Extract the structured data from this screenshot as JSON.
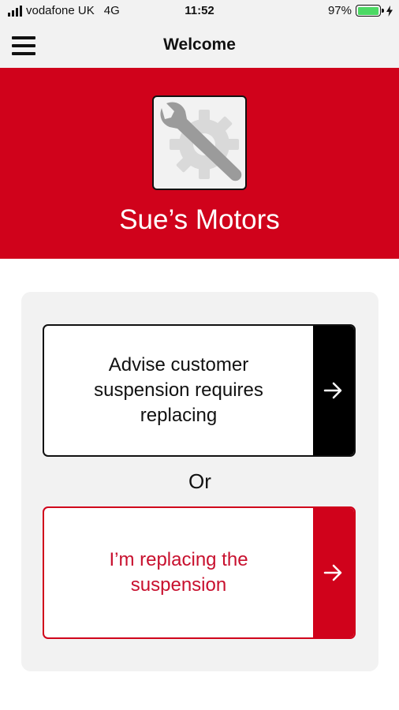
{
  "status_bar": {
    "carrier": "vodafone UK",
    "network": "4G",
    "time": "11:52",
    "battery_percent": "97%",
    "battery_level": 0.97
  },
  "nav": {
    "title": "Welcome",
    "menu_icon": "hamburger-menu-icon"
  },
  "hero": {
    "title": "Sue’s Motors",
    "logo_icon": "wrench-gear-icon",
    "background_color": "#d0021b"
  },
  "options": {
    "advise_label": "Advise customer suspension requires replacing",
    "or_label": "Or",
    "replace_label": "I’m replacing the suspension",
    "arrow_icon": "arrow-right-icon"
  },
  "colors": {
    "brand_red": "#d0021b",
    "dark": "#111111",
    "card_bg": "#f2f2f2",
    "battery_green": "#4cd964"
  }
}
